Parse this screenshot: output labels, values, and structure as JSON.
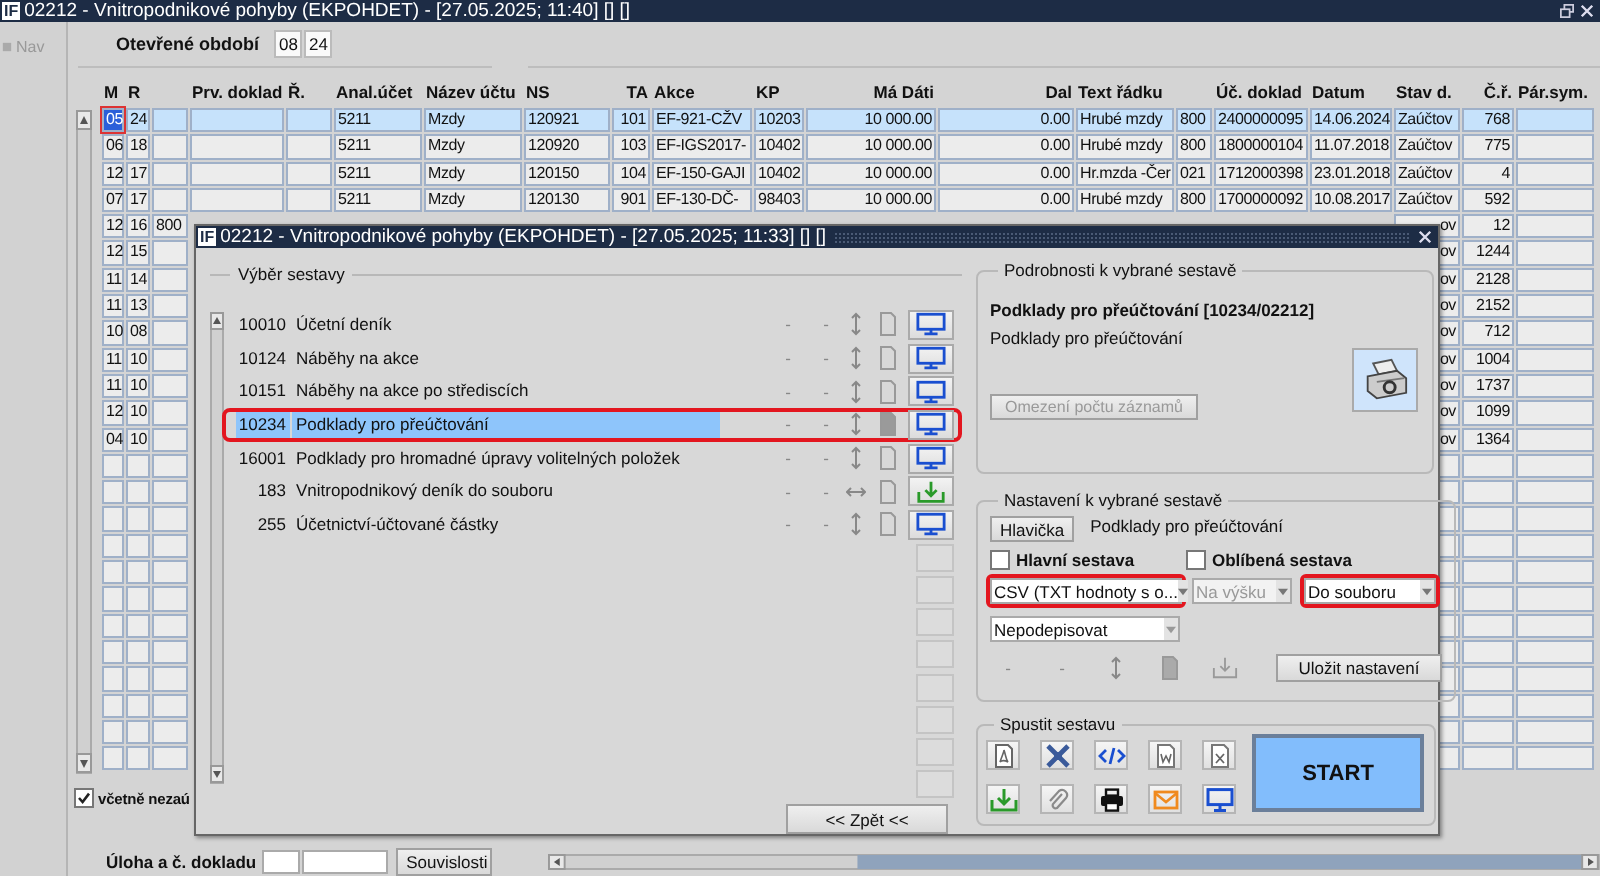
{
  "window": {
    "app_icon": "IF",
    "title": "02212 - Vnitropodnikové pohyby (EKPOHDET) - [27.05.2025; 11:40] [] []"
  },
  "nav": {
    "label": "Nav"
  },
  "period": {
    "label": "Otevřené období",
    "month": "08",
    "year": "24"
  },
  "table": {
    "columns": [
      "M",
      "R",
      null,
      "Prv. doklad",
      "Ř.",
      "Anal.účet",
      "Název účtu",
      "NS",
      "TA",
      "Akce",
      "KP",
      "Má Dáti",
      "Dal",
      "Text řádku",
      null,
      "Úč. doklad",
      "Datum",
      "Stav d.",
      "Č.ř.",
      "Pár.sym."
    ],
    "rows": [
      {
        "selected": true,
        "cells": [
          "05",
          "24",
          null,
          null,
          null,
          "5211",
          "Mzdy",
          "120921",
          "101",
          "EF-921-CŽV",
          "10203",
          "10 000.00",
          "0.00",
          "Hrubé mzdy",
          "800",
          "2400000095",
          "14.06.2024",
          "Zaúčtov",
          "768",
          null
        ]
      },
      {
        "selected": false,
        "cells": [
          "06",
          "18",
          null,
          null,
          null,
          "5211",
          "Mzdy",
          "120920",
          "103",
          "EF-IGS2017-",
          "10402",
          "10 000.00",
          "0.00",
          "Hrubé mzdy",
          "800",
          "1800000104",
          "11.07.2018",
          "Zaúčtov",
          "775",
          null
        ]
      },
      {
        "selected": false,
        "cells": [
          "12",
          "17",
          null,
          null,
          null,
          "5211",
          "Mzdy",
          "120150",
          "104",
          "EF-150-GAJI",
          "10402",
          "10 000.00",
          "0.00",
          "Hr.mzda -Čer",
          "021",
          "1712000398",
          "23.01.2018",
          "Zaúčtov",
          "4",
          null
        ]
      },
      {
        "selected": false,
        "cells": [
          "07",
          "17",
          null,
          null,
          null,
          "5211",
          "Mzdy",
          "120130",
          "901",
          "EF-130-DČ-",
          "98403",
          "10 000.00",
          "0.00",
          "Hrubé mzdy",
          "800",
          "1700000092",
          "10.08.2017",
          "Zaúčtov",
          "592",
          null
        ]
      },
      {
        "selected": false,
        "cells": [
          "12",
          "16",
          "800",
          null,
          null,
          null,
          null,
          null,
          null,
          null,
          null,
          null,
          null,
          null,
          null,
          null,
          null,
          "ov",
          "12",
          null
        ]
      },
      {
        "selected": false,
        "cells": [
          "12",
          "15",
          null,
          null,
          null,
          null,
          null,
          null,
          null,
          null,
          null,
          null,
          null,
          null,
          null,
          null,
          null,
          "ov",
          "1244",
          null
        ]
      },
      {
        "selected": false,
        "cells": [
          "11",
          "14",
          null,
          null,
          null,
          null,
          null,
          null,
          null,
          null,
          null,
          null,
          null,
          null,
          null,
          null,
          null,
          "ov",
          "2128",
          null
        ]
      },
      {
        "selected": false,
        "cells": [
          "11",
          "13",
          null,
          null,
          null,
          null,
          null,
          null,
          null,
          null,
          null,
          null,
          null,
          null,
          null,
          null,
          null,
          "ov",
          "2152",
          null
        ]
      },
      {
        "selected": false,
        "cells": [
          "10",
          "08",
          null,
          null,
          null,
          null,
          null,
          null,
          null,
          null,
          null,
          null,
          null,
          null,
          null,
          null,
          null,
          "ov",
          "712",
          null
        ]
      },
      {
        "selected": false,
        "cells": [
          "11",
          "10",
          null,
          null,
          null,
          null,
          null,
          null,
          null,
          null,
          null,
          null,
          null,
          null,
          null,
          null,
          null,
          "ov",
          "1004",
          null
        ]
      },
      {
        "selected": false,
        "cells": [
          "11",
          "10",
          null,
          null,
          null,
          null,
          null,
          null,
          null,
          null,
          null,
          null,
          null,
          null,
          null,
          null,
          null,
          "ov",
          "1737",
          null
        ]
      },
      {
        "selected": false,
        "cells": [
          "12",
          "10",
          null,
          null,
          null,
          null,
          null,
          null,
          null,
          null,
          null,
          null,
          null,
          null,
          null,
          null,
          null,
          "ov",
          "1099",
          null
        ]
      },
      {
        "selected": false,
        "cells": [
          "04",
          "10",
          null,
          null,
          null,
          null,
          null,
          null,
          null,
          null,
          null,
          null,
          null,
          null,
          null,
          null,
          null,
          "ov",
          "1364",
          null
        ]
      }
    ]
  },
  "include_unposted": {
    "label": "včetně nezaú",
    "checked": true
  },
  "document_lookup": {
    "label": "Úloha a č. dokladu",
    "button": "Souvislosti"
  },
  "dialog": {
    "app_icon": "IF",
    "title": "02212 - Vnitropodnikové pohyby (EKPOHDET) - [27.05.2025; 11:33] [] []",
    "report_list": {
      "title": "Výběr sestavy",
      "items": [
        {
          "number": "10010",
          "name": "Účetní deník",
          "flags": [
            "-",
            "-"
          ],
          "horizontal_arrow": false,
          "kind": "screen",
          "selected": false,
          "highlighted": false
        },
        {
          "number": "10124",
          "name": "Náběhy na akce",
          "flags": [
            "-",
            "-"
          ],
          "horizontal_arrow": false,
          "kind": "screen",
          "selected": false,
          "highlighted": false
        },
        {
          "number": "10151",
          "name": "Náběhy na akce po střediscích",
          "flags": [
            "-",
            "-"
          ],
          "horizontal_arrow": false,
          "kind": "screen",
          "selected": false,
          "highlighted": false
        },
        {
          "number": "10234",
          "name": "Podklady pro přeúčtování",
          "flags": [
            "-",
            "-"
          ],
          "horizontal_arrow": false,
          "kind": "screen",
          "selected": true,
          "highlighted": true
        },
        {
          "number": "16001",
          "name": "Podklady pro hromadné úpravy volitelných položek",
          "flags": [
            "-",
            "-"
          ],
          "horizontal_arrow": false,
          "kind": "screen",
          "selected": false,
          "highlighted": false
        },
        {
          "number": "183",
          "name": "Vnitropodnikový deník do souboru",
          "flags": [
            "-",
            "-"
          ],
          "horizontal_arrow": true,
          "kind": "download",
          "selected": false,
          "highlighted": false
        },
        {
          "number": "255",
          "name": "Účetnictví-účtované částky",
          "flags": [
            "-",
            "-"
          ],
          "horizontal_arrow": false,
          "kind": "screen",
          "selected": false,
          "highlighted": false
        }
      ]
    },
    "back_button": "<< Zpět <<",
    "details": {
      "title": "Podrobnosti k vybrané sestavě",
      "heading": "Podklady pro přeúčtování [10234/02212]",
      "description": "Podklady pro přeúčtování",
      "limit_button": {
        "label": "Omezení počtu záznamů",
        "disabled": true
      }
    },
    "settings": {
      "title": "Nastavení k vybrané sestavě",
      "header_button": "Hlavička",
      "header_text": "Podklady pro přeúčtování",
      "checkboxes": [
        {
          "label": "Hlavní sestava",
          "checked": false
        },
        {
          "label": "Oblíbená sestava",
          "checked": false
        }
      ],
      "selects": [
        {
          "value": "CSV (TXT hodnoty s o...",
          "disabled": false,
          "highlighted": true
        },
        {
          "value": "Na výšku",
          "disabled": true,
          "highlighted": false
        },
        {
          "value": "Do souboru",
          "disabled": false,
          "highlighted": true
        },
        {
          "value": "Nepodepisovat",
          "disabled": false,
          "highlighted": false
        }
      ],
      "flags": [
        "-",
        "-"
      ],
      "save_button": "Uložit nastavení"
    },
    "run": {
      "title": "Spustit sestavu",
      "buttons": [
        {
          "kind": "pdf"
        },
        {
          "kind": "xml"
        },
        {
          "kind": "html"
        },
        {
          "kind": "word"
        },
        {
          "kind": "excel"
        },
        {
          "kind": "download"
        },
        {
          "kind": "attach"
        },
        {
          "kind": "print"
        },
        {
          "kind": "mail"
        },
        {
          "kind": "screen"
        }
      ],
      "start_button": "START"
    }
  }
}
